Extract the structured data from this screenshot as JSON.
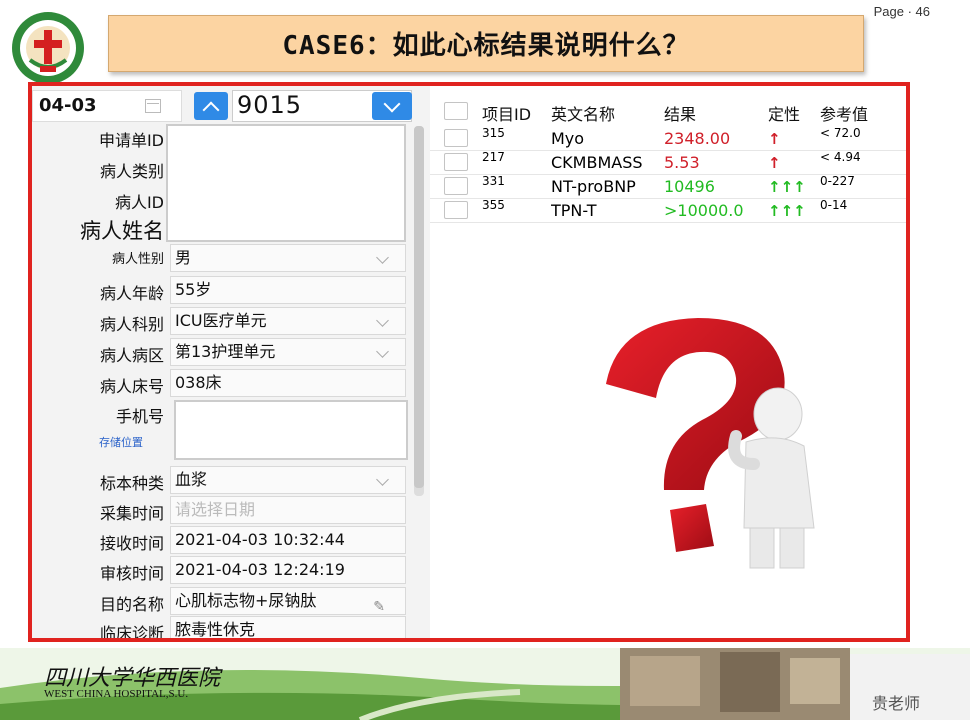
{
  "header": {
    "title": "CASE6：如此心标结果说明什么？",
    "page_label": "Page · 46"
  },
  "search": {
    "date": "04-03",
    "number": "9015"
  },
  "form": {
    "request_id_label": "申请单ID",
    "patient_type_label": "病人类别",
    "patient_id_label": "病人ID",
    "patient_name_label": "病人姓名",
    "gender_label": "病人性别",
    "gender_value": "男",
    "age_label": "病人年龄",
    "age_value": "55岁",
    "dept_label": "病人科别",
    "dept_value": "ICU医疗单元",
    "ward_label": "病人病区",
    "ward_value": "第13护理单元",
    "bed_label": "病人床号",
    "bed_value": "038床",
    "phone_label": "手机号",
    "storage_link": "存储位置",
    "specimen_label": "标本种类",
    "specimen_value": "血浆",
    "collect_label": "采集时间",
    "collect_placeholder": "请选择日期",
    "receive_label": "接收时间",
    "receive_value": "2021-04-03 10:32:44",
    "review_label": "审核时间",
    "review_value": "2021-04-03 12:24:19",
    "purpose_label": "目的名称",
    "purpose_value": "心肌标志物+尿钠肽",
    "diagnosis_label": "临床诊断",
    "diagnosis_value": "脓毒性休克"
  },
  "table": {
    "headers": [
      "项目ID",
      "英文名称",
      "结果",
      "定性",
      "参考值"
    ],
    "rows": [
      {
        "id": "315",
        "name": "Myo",
        "result": "2348.00",
        "flag": "↑",
        "ref": "< 72.0",
        "result_color": "#d0202a",
        "flag_color": "#d0202a"
      },
      {
        "id": "217",
        "name": "CKMBMASS",
        "result": "5.53",
        "flag": "↑",
        "ref": "< 4.94",
        "result_color": "#d0202a",
        "flag_color": "#d0202a"
      },
      {
        "id": "331",
        "name": "NT-proBNP",
        "result": "10496",
        "flag": "↑↑↑",
        "ref": "0-227",
        "result_color": "#22bb22",
        "flag_color": "#22bb22"
      },
      {
        "id": "355",
        "name": "TPN-T",
        "result": ">10000.0",
        "flag": "↑↑↑",
        "ref": "0-14",
        "result_color": "#22bb22",
        "flag_color": "#22bb22"
      }
    ]
  },
  "footer": {
    "hospital_cn": "四川大学华西医院",
    "hospital_en": "WEST CHINA HOSPITAL,S.U.",
    "teacher": "贵老师"
  },
  "colors": {
    "frame": "#e0231f",
    "title_bg": "#fcd4a2",
    "accent_blue": "#2f8ae6"
  }
}
